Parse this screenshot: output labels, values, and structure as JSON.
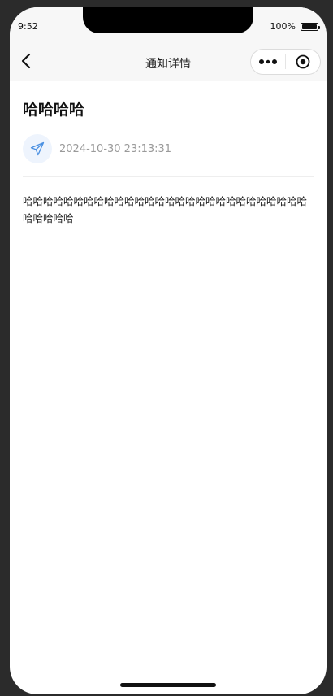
{
  "statusbar": {
    "time": "9:52",
    "battery": "100%",
    "battery_level": 1.0
  },
  "navbar": {
    "title": "通知详情",
    "back_icon": "chevron-left-icon",
    "more_icon": "more-dots-icon",
    "close_icon": "target-circle-icon"
  },
  "notice": {
    "title": "哈哈哈哈",
    "sender_icon": "paper-plane-icon",
    "timestamp": "2024-10-30 23:13:31",
    "body": "哈哈哈哈哈哈哈哈哈哈哈哈哈哈哈哈哈哈哈哈哈哈哈哈哈哈哈哈哈哈哈哈哈"
  },
  "colors": {
    "accent": "#4a90e2",
    "nav_bg": "#f7f7f7",
    "timestamp": "#9a9a9a"
  }
}
